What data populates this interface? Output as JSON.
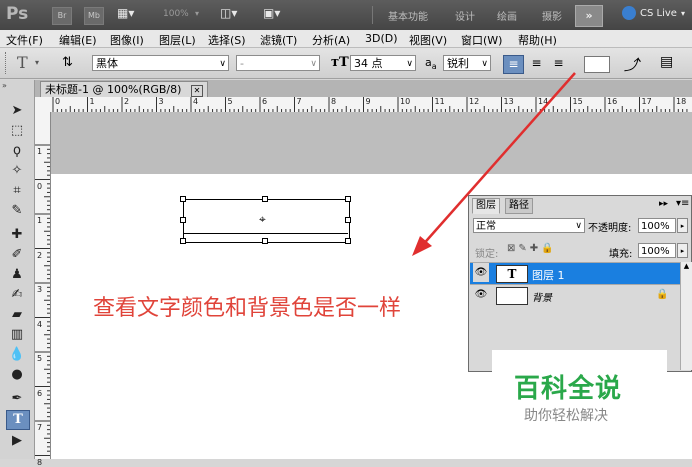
{
  "app": {
    "logo_text": "Ps",
    "btn_br": "Br",
    "btn_mb": "Mb",
    "zoom": "100%"
  },
  "workspaces": [
    "基本功能",
    "设计",
    "绘画",
    "摄影"
  ],
  "cs_live": "CS Live",
  "menu": [
    "文件(F)",
    "编辑(E)",
    "图像(I)",
    "图层(L)",
    "选择(S)",
    "滤镜(T)",
    "分析(A)",
    "3D(D)",
    "视图(V)",
    "窗口(W)",
    "帮助(H)"
  ],
  "options": {
    "tool_letter": "T",
    "font_family": "黑体",
    "font_style": "-",
    "font_size": "34 点",
    "aa_label": "a",
    "aa_sub": "a",
    "aa_value": "锐利"
  },
  "document": {
    "tab_title": "未标题-1 @ 100%(RGB/8)",
    "close_glyph": "✕",
    "ruler_h_labels": [
      "0",
      "1",
      "2",
      "3",
      "4",
      "5",
      "6",
      "7",
      "8",
      "9",
      "10",
      "11",
      "12",
      "13",
      "14",
      "15",
      "16",
      "17",
      "18"
    ],
    "ruler_v_labels": [
      "1",
      "0",
      "1",
      "2",
      "3",
      "4",
      "5",
      "6",
      "7",
      "8"
    ],
    "annotation": "查看文字颜色和背景色是否一样"
  },
  "layers_panel": {
    "tabs": [
      "图层",
      "路径"
    ],
    "blend_mode": "正常",
    "opacity_label": "不透明度:",
    "opacity_value": "100%",
    "lock_label": "锁定:",
    "fill_label": "填充:",
    "fill_value": "100%",
    "layers": [
      {
        "name": "图层 1",
        "thumb": "T",
        "selected": true
      },
      {
        "name": "背景",
        "thumb": "",
        "selected": false
      }
    ]
  },
  "watermark": {
    "title": "百科全说",
    "subtitle": "助你轻松解决"
  },
  "colors": {
    "accent_blue": "#1a7fe0",
    "annotation_red": "#e0443a",
    "arrow_red": "#e02e2e",
    "watermark_green": "#2aa84a"
  }
}
